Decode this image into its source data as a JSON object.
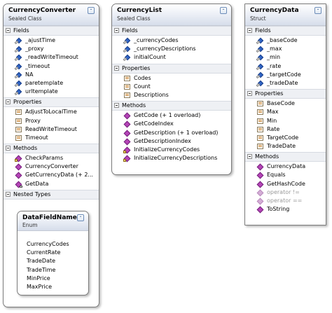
{
  "currency_converter": {
    "name": "CurrencyConverter",
    "stereotype": "Sealed Class",
    "fields_label": "Fields",
    "fields": [
      "_ajustTime",
      "_proxy",
      "_readWriteTimeout",
      "_timeout",
      "NA",
      "paretemplate",
      "urltemplate"
    ],
    "properties_label": "Properties",
    "properties": [
      "AdjustToLocalTime",
      "Proxy",
      "ReadWriteTimeout",
      "Timeout"
    ],
    "methods_label": "Methods",
    "methods": [
      "CheckParams",
      "CurrencyConverter",
      "GetCurrencyData (+ 2...",
      "GetData"
    ],
    "nested_label": "Nested Types"
  },
  "data_field_names": {
    "name": "DataFieldNames",
    "stereotype": "Enum",
    "values": [
      "CurrencyCodes",
      "CurrentRate",
      "TradeDate",
      "TradeTime",
      "MinPrice",
      "MaxPrice"
    ]
  },
  "currency_list": {
    "name": "CurrencyList",
    "stereotype": "Sealed Class",
    "fields_label": "Fields",
    "fields": [
      "_currencyCodes",
      "_currencyDescriptions",
      "initialCount"
    ],
    "properties_label": "Properties",
    "properties": [
      "Codes",
      "Count",
      "Descriptions"
    ],
    "methods_label": "Methods",
    "methods": [
      "GetCode (+ 1 overload)",
      "GetCodeIndex",
      "GetDescription (+ 1 overload)",
      "GetDescriptionIndex",
      "InitializeCurrencyCodes",
      "InitializeCurrencyDescriptions"
    ]
  },
  "currency_data": {
    "name": "CurrencyData",
    "stereotype": "Struct",
    "fields_label": "Fields",
    "fields": [
      "_baseCode",
      "_max",
      "_min",
      "_rate",
      "_targetCode",
      "_tradeDate"
    ],
    "properties_label": "Properties",
    "properties": [
      "BaseCode",
      "Max",
      "Min",
      "Rate",
      "TargetCode",
      "TradeDate"
    ],
    "methods_label": "Methods",
    "methods": [
      "CurrencyData",
      "Equals",
      "GetHashCode",
      "operator !=",
      "operator ==",
      "ToString"
    ]
  },
  "icons": {
    "collapse": "double-chevron-up-icon",
    "section_toggle": "minus-box-icon",
    "field": "field-icon",
    "property": "property-icon",
    "method": "method-icon"
  },
  "colors": {
    "header_gradient_end": "#d6ddea",
    "field_icon": "#2f64c6",
    "method_icon": "#b644b8",
    "muted_text": "#9a9a9a"
  }
}
